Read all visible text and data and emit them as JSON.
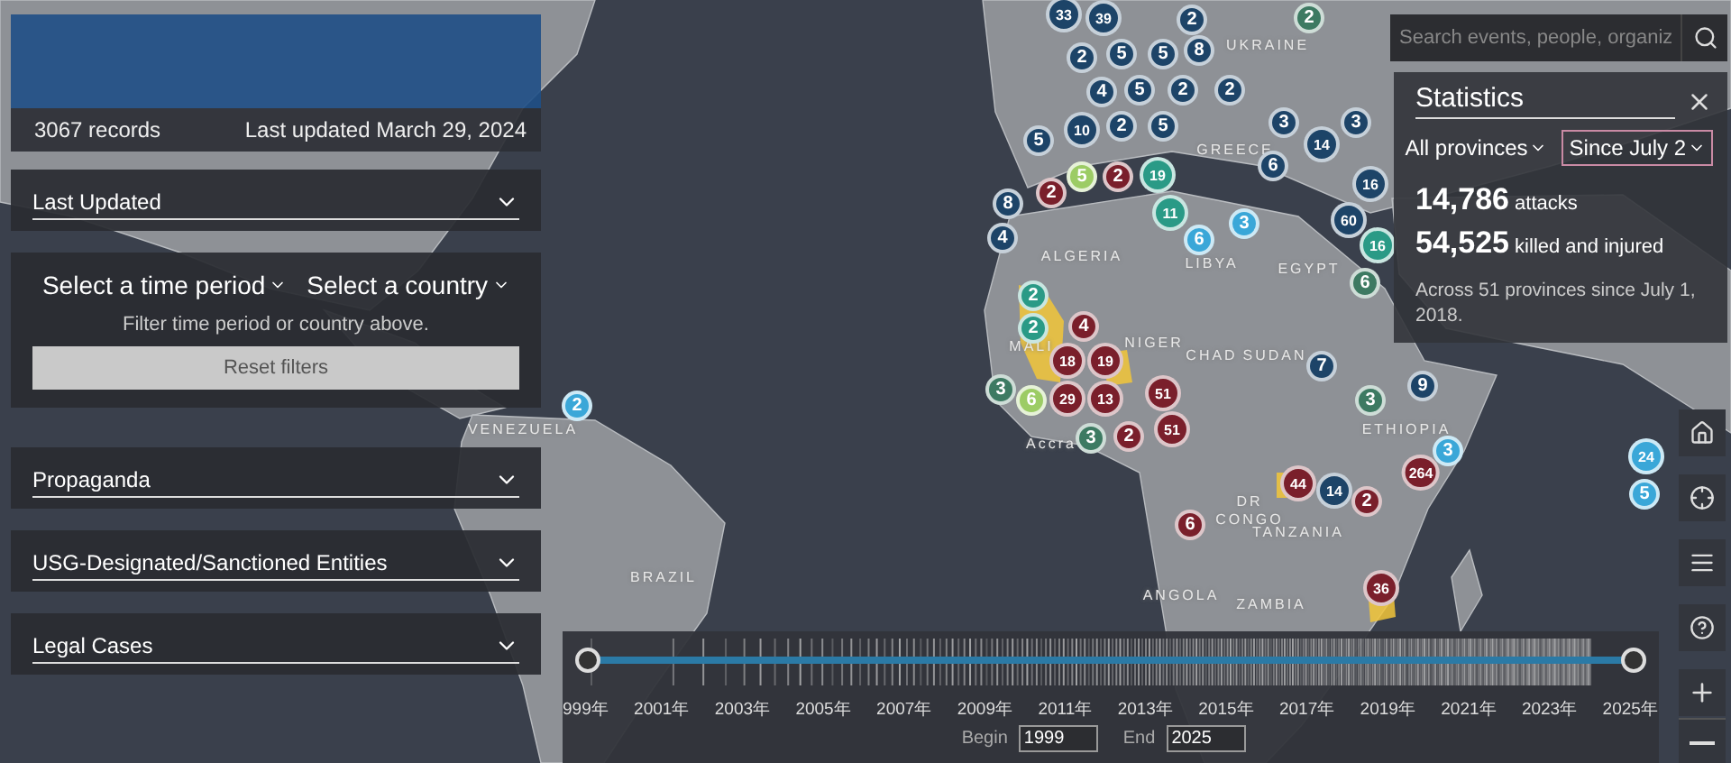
{
  "header": {
    "records": "3067 records",
    "updated": "Last updated March 29, 2024"
  },
  "sections_top": [
    {
      "title": "Last Updated",
      "expanded": false
    }
  ],
  "filters": {
    "dropdowns": [
      "Select a time period",
      "Select a country"
    ],
    "hint": "Filter time period or country above.",
    "reset": "Reset filters"
  },
  "sections": [
    {
      "title": "Propaganda",
      "expanded": false
    },
    {
      "title": "USG-Designated/Sanctioned Entities",
      "expanded": false
    },
    {
      "title": "Legal Cases",
      "expanded": false
    }
  ],
  "search": {
    "placeholder": "Search events, people, organiz"
  },
  "statistics": {
    "title": "Statistics",
    "dropdowns": [
      {
        "label": "All provinces",
        "focused": false
      },
      {
        "label": "Since July 2",
        "focused": true
      }
    ],
    "figures": [
      "**14,786** attacks",
      "**54,525** killed and injured"
    ],
    "note": "Across 51 provinces since July 1, 2018."
  },
  "tools": [
    {
      "kind": "home"
    },
    {
      "kind": "locate"
    },
    {
      "kind": "list"
    },
    {
      "kind": "help"
    },
    {
      "kind": "zoom-in"
    },
    {
      "kind": "zoom-out"
    }
  ],
  "map": {
    "labels": [
      "UKRAINE",
      "GREECE",
      "ALGERIA",
      "LIBYA",
      "EGYPT",
      "MALI",
      "NIGER",
      "CHAD",
      "SUDAN",
      "ETHIOPIA",
      "VENEZUELA",
      "Accra",
      "DR",
      "CONGO",
      "TANZANIA",
      "BRAZIL",
      "ANGOLA",
      "ZAMBIA"
    ],
    "clusters": [
      {
        "label": "33",
        "color": "#1d4468"
      },
      {
        "label": "39",
        "color": "#1d4468"
      },
      {
        "label": "2",
        "color": "#1d4468"
      },
      {
        "label": "2",
        "color": "#3d7a62"
      },
      {
        "label": "2",
        "color": "#1d4468"
      },
      {
        "label": "5",
        "color": "#1d4468"
      },
      {
        "label": "5",
        "color": "#1d4468"
      },
      {
        "label": "4",
        "color": "#1d4468"
      },
      {
        "label": "2",
        "color": "#1d4468"
      },
      {
        "label": "2",
        "color": "#1d4468"
      },
      {
        "label": "8",
        "color": "#1d4468"
      },
      {
        "label": "2",
        "color": "#1d4468"
      },
      {
        "label": "5",
        "color": "#1d4468"
      },
      {
        "label": "10",
        "color": "#1d4468"
      },
      {
        "label": "5",
        "color": "#1d4468"
      },
      {
        "label": "5",
        "color": "#1d4468"
      },
      {
        "label": "5",
        "color": "#9ccc65"
      },
      {
        "label": "2",
        "color": "#7a1f2b"
      },
      {
        "label": "19",
        "color": "#2a9a86"
      },
      {
        "label": "2",
        "color": "#7a1f2b"
      },
      {
        "label": "11",
        "color": "#2a9a86"
      },
      {
        "label": "8",
        "color": "#1d4468"
      },
      {
        "label": "4",
        "color": "#1d4468"
      },
      {
        "label": "6",
        "color": "#3aa7d8"
      },
      {
        "label": "3",
        "color": "#3aa7d8"
      },
      {
        "label": "3",
        "color": "#1d4468"
      },
      {
        "label": "6",
        "color": "#1d4468"
      },
      {
        "label": "3",
        "color": "#1d4468"
      },
      {
        "label": "14",
        "color": "#1d4468"
      },
      {
        "label": "16",
        "color": "#1d4468"
      },
      {
        "label": "60",
        "color": "#1d4468"
      },
      {
        "label": "16",
        "color": "#2a9a86"
      },
      {
        "label": "6",
        "color": "#3d7a62"
      },
      {
        "label": "2",
        "color": "#2a9a86"
      },
      {
        "label": "2",
        "color": "#2a9a86"
      },
      {
        "label": "4",
        "color": "#7a1f2b"
      },
      {
        "label": "18",
        "color": "#7a1f2b"
      },
      {
        "label": "19",
        "color": "#7a1f2b"
      },
      {
        "label": "29",
        "color": "#7a1f2b"
      },
      {
        "label": "13",
        "color": "#7a1f2b"
      },
      {
        "label": "3",
        "color": "#3d7a62"
      },
      {
        "label": "6",
        "color": "#9ccc65"
      },
      {
        "label": "3",
        "color": "#3d7a62"
      },
      {
        "label": "2",
        "color": "#7a1f2b"
      },
      {
        "label": "51",
        "color": "#7a1f2b"
      },
      {
        "label": "51",
        "color": "#7a1f2b"
      },
      {
        "label": "7",
        "color": "#1d4468"
      },
      {
        "label": "3",
        "color": "#3d7a62"
      },
      {
        "label": "44",
        "color": "#7a1f2b"
      },
      {
        "label": "14",
        "color": "#1d4468"
      },
      {
        "label": "2",
        "color": "#7a1f2b"
      },
      {
        "label": "6",
        "color": "#7a1f2b"
      },
      {
        "label": "3",
        "color": "#3aa7d8"
      },
      {
        "label": "264",
        "color": "#7a1f2b"
      },
      {
        "label": "36",
        "color": "#7a1f2b"
      },
      {
        "label": "2",
        "color": "#3aa7d8"
      },
      {
        "label": "24",
        "color": "#3aa7d8"
      },
      {
        "label": "5",
        "color": "#3aa7d8"
      },
      {
        "label": "9",
        "color": "#1d4468"
      }
    ]
  },
  "timeline": {
    "handles": [
      {
        "level": 0
      },
      {
        "level": 1
      }
    ],
    "years": [
      "999年",
      "2001年",
      "2003年",
      "2005年",
      "2007年",
      "2009年",
      "2011年",
      "2013年",
      "2015年",
      "2017年",
      "2019年",
      "2021年",
      "2023年",
      "2025年"
    ],
    "begin_label": "Begin",
    "begin": "1999",
    "end_label": "End",
    "end": "2025"
  }
}
